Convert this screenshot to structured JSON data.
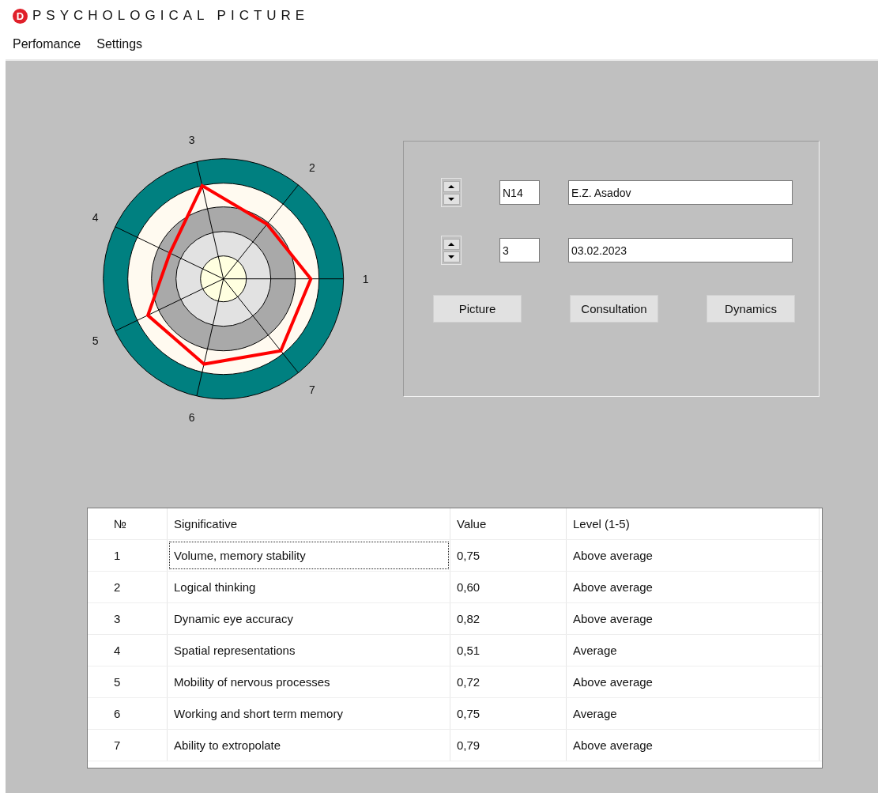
{
  "window": {
    "logo": "D",
    "title": "PSYCHOLOGICAL PICTURE"
  },
  "menu": [
    {
      "label": "Perfomance"
    },
    {
      "label": "Settings"
    }
  ],
  "radar": {
    "axis_labels": [
      "1",
      "2",
      "3",
      "4",
      "5",
      "6",
      "7"
    ]
  },
  "panel": {
    "rows": [
      {
        "code": "N14",
        "text": "E.Z. Asadov"
      },
      {
        "code": "3",
        "text": "03.02.2023"
      }
    ],
    "buttons": [
      "Picture",
      "Consultation",
      "Dynamics"
    ]
  },
  "table": {
    "columns": [
      "№",
      "Significative",
      "Value",
      "Level (1-5)"
    ],
    "rows": [
      {
        "no": "1",
        "name": "Volume, memory stability",
        "value": "0,75",
        "level": "Above average",
        "selected": true
      },
      {
        "no": "2",
        "name": "Logical thinking",
        "value": "0,60",
        "level": "Above average",
        "selected": false
      },
      {
        "no": "3",
        "name": "Dynamic eye accuracy",
        "value": "0,82",
        "level": "Above average",
        "selected": false
      },
      {
        "no": "4",
        "name": "Spatial representations",
        "value": "0,51",
        "level": "Average",
        "selected": false
      },
      {
        "no": "5",
        "name": "Mobility of nervous processes",
        "value": "0,72",
        "level": "Above average",
        "selected": false
      },
      {
        "no": "6",
        "name": "Working and short term memory",
        "value": "0,75",
        "level": "Average",
        "selected": false
      },
      {
        "no": "7",
        "name": "Ability to extropolate",
        "value": "0,79",
        "level": "Above average",
        "selected": false
      }
    ]
  }
}
